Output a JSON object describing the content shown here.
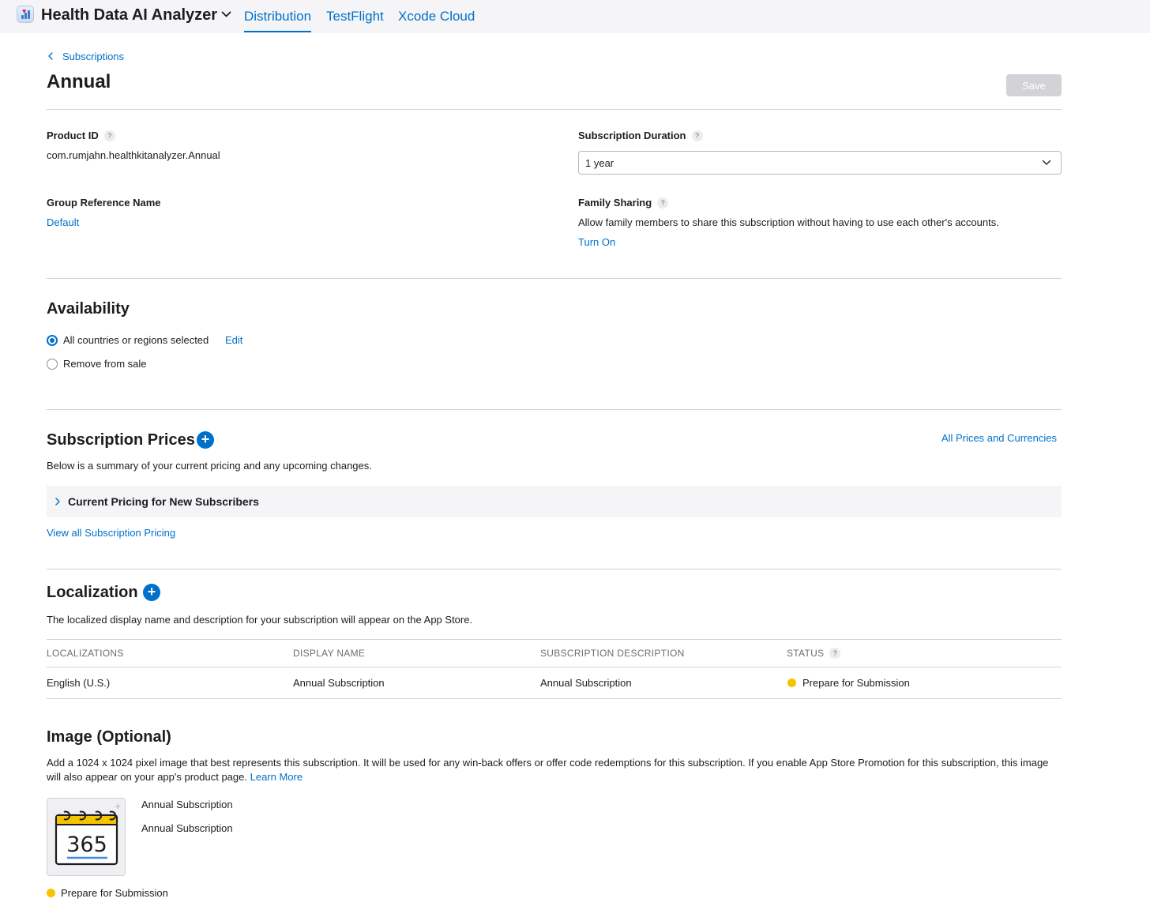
{
  "header": {
    "app_name": "Health Data AI Analyzer",
    "tabs": [
      {
        "label": "Distribution",
        "active": true
      },
      {
        "label": "TestFlight",
        "active": false
      },
      {
        "label": "Xcode Cloud",
        "active": false
      }
    ]
  },
  "breadcrumb": "Subscriptions",
  "page_title": "Annual",
  "save_label": "Save",
  "details": {
    "product_id_label": "Product ID",
    "product_id_value": "com.rumjahn.healthkitanalyzer.Annual",
    "group_ref_label": "Group Reference Name",
    "group_ref_value": "Default",
    "duration_label": "Subscription Duration",
    "duration_value": "1 year",
    "family_label": "Family Sharing",
    "family_desc": "Allow family members to share this subscription without having to use each other's accounts.",
    "family_action": "Turn On"
  },
  "availability": {
    "title": "Availability",
    "option_all": "All countries or regions selected",
    "edit": "Edit",
    "option_remove": "Remove from sale",
    "selected": "all"
  },
  "prices": {
    "title": "Subscription Prices",
    "all_link": "All Prices and Currencies",
    "summary": "Below is a summary of your current pricing and any upcoming changes.",
    "current_row": "Current Pricing for New Subscribers",
    "view_all": "View all Subscription Pricing"
  },
  "localization": {
    "title": "Localization",
    "desc": "The localized display name and description for your subscription will appear on the App Store.",
    "columns": [
      "LOCALIZATIONS",
      "DISPLAY NAME",
      "SUBSCRIPTION DESCRIPTION",
      "STATUS"
    ],
    "row": {
      "locale": "English (U.S.)",
      "display_name": "Annual Subscription",
      "description": "Annual Subscription",
      "status": "Prepare for Submission"
    }
  },
  "image_section": {
    "title": "Image (Optional)",
    "desc": "Add a 1024 x 1024 pixel image that best represents this subscription. It will be used for any win-back offers or offer code redemptions for this subscription. If you enable App Store Promotion for this subscription, this image will also appear on your app's product page.",
    "learn_more": "Learn More",
    "image_text": "365",
    "name": "Annual Subscription",
    "description": "Annual Subscription",
    "status": "Prepare for Submission"
  },
  "colors": {
    "accent": "#0070c9",
    "status_pending": "#f5c400"
  }
}
